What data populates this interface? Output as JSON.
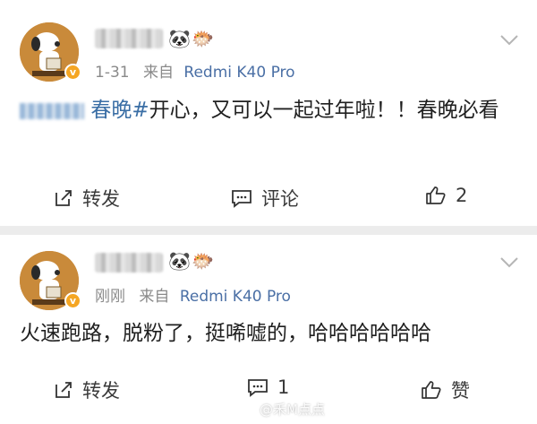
{
  "posts": [
    {
      "meta_time": "1-31",
      "meta_source_prefix": "来自",
      "meta_device": "Redmi K40 Pro",
      "emojis": [
        "🐼",
        "🐡"
      ],
      "topic_text": "春晚#",
      "body_text": "开心，又可以一起过年啦！！春晚必看",
      "actions": {
        "repost": "转发",
        "comment": "评论",
        "like": "2"
      }
    },
    {
      "meta_time": "刚刚",
      "meta_source_prefix": "来自",
      "meta_device": "Redmi K40 Pro",
      "emojis": [
        "🐼",
        "🐡"
      ],
      "body_text": "火速跑路，脱粉了，挺唏嘘的，哈哈哈哈哈哈",
      "actions": {
        "repost": "转发",
        "comment": "1",
        "like": "赞"
      }
    }
  ],
  "watermark": {
    "text": "@禾M点点"
  },
  "colors": {
    "link": "#3a6ea5",
    "device": "#4a6fa5",
    "meta": "#8a8a8a",
    "badge": "#f5a623"
  }
}
